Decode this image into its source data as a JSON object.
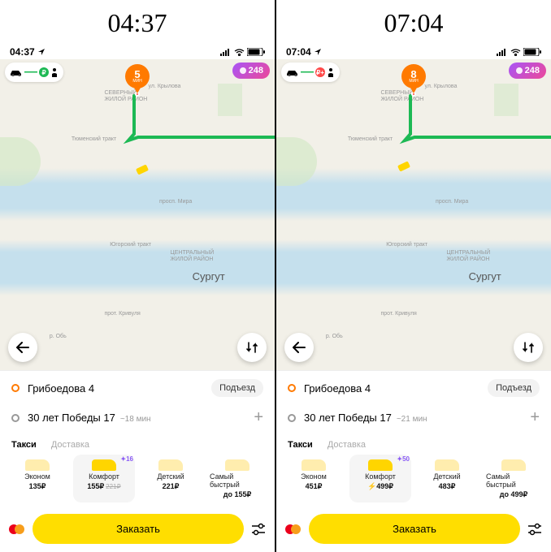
{
  "left": {
    "header_time": "04:37",
    "statusbar_time": "04:37",
    "points_badge": "248",
    "eta_min": "5",
    "eta_label": "МИН",
    "city": "Сургут",
    "district1": "СЕВЕРНЫЙ",
    "district2": "ЖИЛОЙ РАЙОН",
    "district3": "ЦЕНТРАЛЬНЫЙ",
    "district4": "ЖИЛОЙ РАЙОН",
    "street1": "ул. Крылова",
    "street2": "Тюменский тракт",
    "street3": "просп. Мира",
    "street4": "Югорский тракт",
    "street5": "прот. Кривуля",
    "street6": "р. Обь",
    "pickup": "Грибоедова 4",
    "entrance": "Подъезд",
    "dest": "30 лет Победы 17",
    "trip_time": "~18 мин",
    "tab_taxi": "Такси",
    "tab_delivery": "Доставка",
    "fares": [
      {
        "name": "Эконом",
        "price": "135₽"
      },
      {
        "name": "Комфорт",
        "price": "155₽",
        "old": "221₽",
        "badge": "16",
        "selected": true
      },
      {
        "name": "Детский",
        "price": "221₽"
      },
      {
        "name": "Самый быстрый",
        "price": "до 155₽"
      }
    ],
    "order": "Заказать"
  },
  "right": {
    "header_time": "07:04",
    "statusbar_time": "07:04",
    "points_badge": "248",
    "eta_min": "8",
    "eta_label": "МИН",
    "city": "Сургут",
    "district1": "СЕВЕРНЫЙ",
    "district2": "ЖИЛОЙ РАЙОН",
    "district3": "ЦЕНТРАЛЬНЫЙ",
    "district4": "ЖИЛОЙ РАЙОН",
    "street1": "ул. Крылова",
    "street2": "Тюменский тракт",
    "street3": "просп. Мира",
    "street4": "Югорский тракт",
    "street5": "прот. Кривуля",
    "street6": "р. Обь",
    "pickup": "Грибоедова 4",
    "entrance": "Подъезд",
    "dest": "30 лет Победы 17",
    "trip_time": "~21 мин",
    "tab_taxi": "Такси",
    "tab_delivery": "Доставка",
    "fares": [
      {
        "name": "Эконом",
        "price": "451₽"
      },
      {
        "name": "Комфорт",
        "price": "499₽",
        "surge": true,
        "badge": "50",
        "selected": true
      },
      {
        "name": "Детский",
        "price": "483₽"
      },
      {
        "name": "Самый быстрый",
        "price": "до 499₽"
      }
    ],
    "order": "Заказать"
  }
}
